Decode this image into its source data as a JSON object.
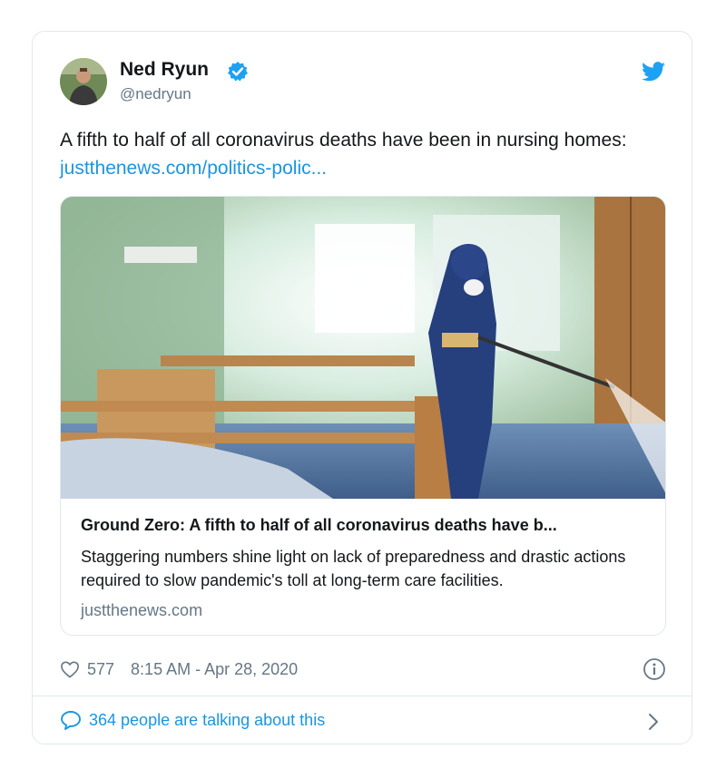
{
  "author": {
    "name": "Ned Ryun",
    "handle": "@nedryun"
  },
  "tweet": {
    "text": "A fifth to half of all coronavirus deaths have been in nursing homes: ",
    "link": "justthenews.com/politics-polic..."
  },
  "card": {
    "title": "Ground Zero: A fifth to half of all coronavirus deaths have b...",
    "description": "Staggering numbers shine light on lack of preparedness and drastic actions required to slow pandemic's toll at long-term care facilities.",
    "domain": "justthenews.com"
  },
  "meta": {
    "likes": "577",
    "timestamp": "8:15 AM - Apr 28, 2020"
  },
  "footer": {
    "talking": "364 people are talking about this"
  },
  "colors": {
    "link": "#1b95e0",
    "muted": "#657786",
    "border": "#e1e8ed"
  },
  "icons": [
    "verified-badge-icon",
    "twitter-bird-icon",
    "heart-icon",
    "info-icon",
    "comment-bubble-icon",
    "chevron-right-icon"
  ]
}
